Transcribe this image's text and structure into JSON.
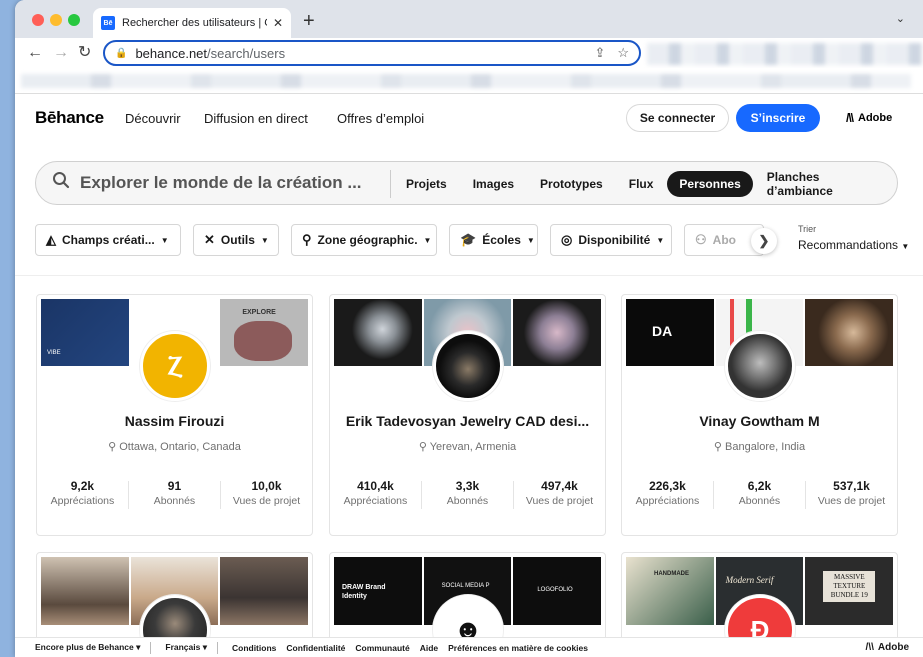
{
  "browser": {
    "tab_title": "Rechercher des utilisateurs | G",
    "favicon_text": "Bē",
    "url_host": "behance.net",
    "url_path": "/search/users"
  },
  "header": {
    "logo": "Bēhance",
    "nav": [
      "Découvrir",
      "Diffusion en direct",
      "Offres d’emploi"
    ],
    "login": "Se connecter",
    "signup": "S’inscrire",
    "adobe": "Adobe"
  },
  "search": {
    "placeholder": "Explorer le monde de la création ...",
    "tabs": [
      "Projets",
      "Images",
      "Prototypes",
      "Flux",
      "Personnes",
      "Planches d’ambiance"
    ],
    "active_tab": "Personnes"
  },
  "filters": {
    "items": [
      {
        "label": "Champs créati...",
        "icon": "shapes-icon"
      },
      {
        "label": "Outils",
        "icon": "tools-icon"
      },
      {
        "label": "Zone géographic.",
        "icon": "location-icon"
      },
      {
        "label": "Écoles",
        "icon": "graduation-icon"
      },
      {
        "label": "Disponibilité",
        "icon": "availability-icon"
      },
      {
        "label": "Abo",
        "icon": "subscription-icon"
      }
    ],
    "sort_label": "Trier",
    "sort_value": "Recommandations"
  },
  "cards": [
    {
      "name": "Nassim Firouzi",
      "location": "Ottawa, Ontario, Canada",
      "stats": [
        {
          "value": "9,2k",
          "label": "Appréciations"
        },
        {
          "value": "91",
          "label": "Abonnés"
        },
        {
          "value": "10,0k",
          "label": "Vues de projet"
        }
      ],
      "thumb_text": [
        "VIBE",
        "",
        "EXPLORE"
      ],
      "thumb_colors": [
        "#1d3a6e",
        "#ffffff",
        "#b9b9b9"
      ],
      "avatar_color": "#f2b400"
    },
    {
      "name": "Erik Tadevosyan Jewelry CAD desi...",
      "location": "Yerevan, Armenia",
      "stats": [
        {
          "value": "410,4k",
          "label": "Appréciations"
        },
        {
          "value": "3,3k",
          "label": "Abonnés"
        },
        {
          "value": "497,4k",
          "label": "Vues de projet"
        }
      ],
      "thumb_text": [
        "",
        "",
        ""
      ],
      "thumb_colors": [
        "#1a1a1a",
        "#c8cfd6",
        "#222"
      ],
      "avatar_color": "#111111"
    },
    {
      "name": "Vinay Gowtham M",
      "location": "Bangalore, India",
      "stats": [
        {
          "value": "226,3k",
          "label": "Appréciations"
        },
        {
          "value": "6,2k",
          "label": "Abonnés"
        },
        {
          "value": "537,1k",
          "label": "Vues de projet"
        }
      ],
      "thumb_text": [
        "DA",
        "",
        ""
      ],
      "thumb_colors": [
        "#0a0a0a",
        "#f4f4f4",
        "#3a2a1e"
      ],
      "avatar_color": "#555555"
    }
  ],
  "row2": [
    {
      "thumb_colors": [
        "#5a4a3e",
        "#c9a98a",
        "#3b3432"
      ],
      "thumb_text": [
        "",
        "",
        ""
      ],
      "avatar_color": "#222"
    },
    {
      "thumb_colors": [
        "#0d0d0d",
        "#111111",
        "#0d0d0d"
      ],
      "thumb_text": [
        "DRAW Brand Identity",
        "SOCIAL MEDIA P",
        "LOGOFOLIO"
      ],
      "avatar_color": "#ffffff"
    },
    {
      "thumb_colors": [
        "#3a5f4a",
        "#e4dccb",
        "#2b2b2b"
      ],
      "thumb_text": [
        "HANDMADE",
        "Modern Serif",
        "MASSIVE TEXTURE BUNDLE 19"
      ],
      "avatar_color": "#ef3b3b"
    }
  ],
  "footer": {
    "more": "Encore plus de Behance",
    "language": "Français",
    "links": [
      "Conditions",
      "Confidentialité",
      "Communauté",
      "Aide",
      "Préférences en matière de cookies"
    ],
    "adobe": "Adobe"
  }
}
